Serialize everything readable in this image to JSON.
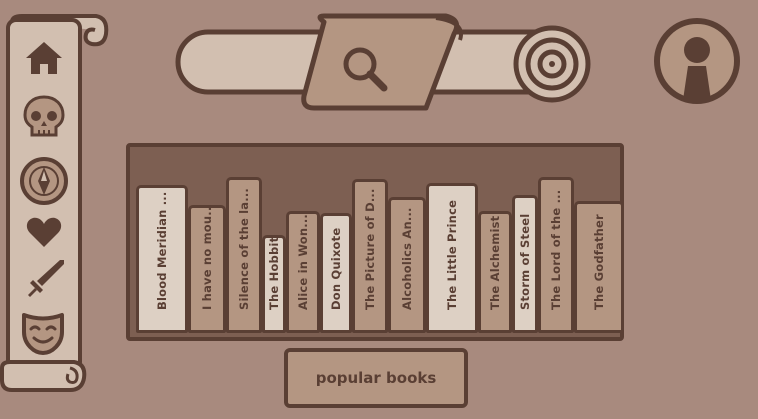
{
  "colors": {
    "background": "#a88a7e",
    "parchment": "#d2bfb0",
    "parchment_dark": "#b49682",
    "ink": "#5a3f34"
  },
  "sidebar": {
    "items": [
      {
        "icon": "home-icon"
      },
      {
        "icon": "skull-icon"
      },
      {
        "icon": "compass-icon"
      },
      {
        "icon": "heart-icon"
      },
      {
        "icon": "sword-icon"
      },
      {
        "icon": "mask-icon"
      }
    ]
  },
  "search": {
    "icon": "search-icon"
  },
  "profile": {
    "icon": "user-icon"
  },
  "shelf": {
    "books": [
      {
        "title": "Blood Meridian ...",
        "shade": "light"
      },
      {
        "title": "I have no mou...",
        "shade": "dark"
      },
      {
        "title": "Silence of the la...",
        "shade": "dark"
      },
      {
        "title": "The Hobbit",
        "shade": "light"
      },
      {
        "title": "Alice in Won...",
        "shade": "dark"
      },
      {
        "title": "Don Quixote",
        "shade": "light"
      },
      {
        "title": "The Picture of D...",
        "shade": "dark"
      },
      {
        "title": "Alcoholics An...",
        "shade": "dark"
      },
      {
        "title": "The Little Prince",
        "shade": "light"
      },
      {
        "title": "The Alchemist",
        "shade": "dark"
      },
      {
        "title": "Storm of Steel",
        "shade": "light"
      },
      {
        "title": "The Lord of the ...",
        "shade": "dark"
      },
      {
        "title": "The Godfather",
        "shade": "dark"
      }
    ]
  },
  "popular_button": {
    "label": "popular books"
  }
}
